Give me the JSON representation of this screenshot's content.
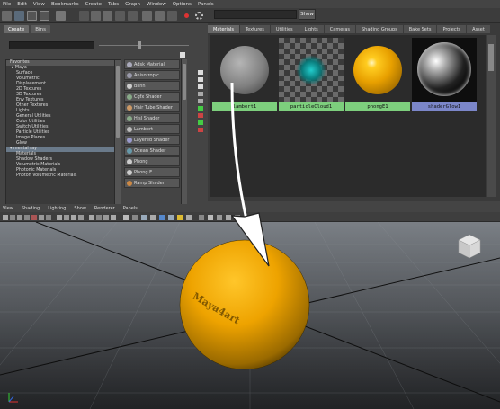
{
  "menubar": [
    "File",
    "Edit",
    "View",
    "Bookmarks",
    "Create",
    "Tabs",
    "Graph",
    "Window",
    "Options",
    "Panels"
  ],
  "toolbar": {
    "show_label": "Show"
  },
  "left_pane": {
    "tabs": [
      "Create",
      "Bins"
    ],
    "tree": [
      {
        "label": "Favorites",
        "kind": "header"
      },
      {
        "label": "▸ Maya",
        "kind": "cat"
      },
      {
        "label": "Surface",
        "kind": "item"
      },
      {
        "label": "Volumetric",
        "kind": "item"
      },
      {
        "label": "Displacement",
        "kind": "item"
      },
      {
        "label": "2D Textures",
        "kind": "item"
      },
      {
        "label": "3D Textures",
        "kind": "item"
      },
      {
        "label": "Env Textures",
        "kind": "item"
      },
      {
        "label": "Other Textures",
        "kind": "item"
      },
      {
        "label": "Lights",
        "kind": "item"
      },
      {
        "label": "General Utilities",
        "kind": "item"
      },
      {
        "label": "Color Utilities",
        "kind": "item"
      },
      {
        "label": "Switch Utilities",
        "kind": "item"
      },
      {
        "label": "Particle Utilities",
        "kind": "item"
      },
      {
        "label": "Image Planes",
        "kind": "item"
      },
      {
        "label": "Glow",
        "kind": "item"
      },
      {
        "label": "▾ mental ray",
        "kind": "sel"
      },
      {
        "label": "Materials",
        "kind": "item"
      },
      {
        "label": "Shadow Shaders",
        "kind": "item"
      },
      {
        "label": "Volumetric Materials",
        "kind": "item"
      },
      {
        "label": "Photonic Materials",
        "kind": "item"
      },
      {
        "label": "Photon Volumetric Materials",
        "kind": "item"
      }
    ],
    "shaders": [
      {
        "label": "Adsk Material",
        "color": "#aab"
      },
      {
        "label": "Anisotropic",
        "color": "#99a"
      },
      {
        "label": "Blinn",
        "color": "#ccc"
      },
      {
        "label": "Cgfx Shader",
        "color": "#8a8"
      },
      {
        "label": "Hair Tube Shader",
        "color": "#c96"
      },
      {
        "label": "Hlsl Shader",
        "color": "#8a8"
      },
      {
        "label": "Lambert",
        "color": "#bbb"
      },
      {
        "label": "Layered Shader",
        "color": "#99c"
      },
      {
        "label": "Ocean Shader",
        "color": "#69a"
      },
      {
        "label": "Phong",
        "color": "#ccc"
      },
      {
        "label": "Phong E",
        "color": "#ccc"
      },
      {
        "label": "Ramp Shader",
        "color": "#c84"
      }
    ]
  },
  "right_pane": {
    "tabs": [
      "Materials",
      "Textures",
      "Utilities",
      "Lights",
      "Cameras",
      "Shading Groups",
      "Bake Sets",
      "Projects",
      "Asset"
    ],
    "swatches": [
      {
        "name": "lambert1",
        "selected": false
      },
      {
        "name": "particleCloud1",
        "selected": false
      },
      {
        "name": "phongE1",
        "selected": false
      },
      {
        "name": "shaderGlow1",
        "selected": true
      }
    ]
  },
  "viewport": {
    "menu": [
      "View",
      "Shading",
      "Lighting",
      "Show",
      "Renderer",
      "Panels"
    ],
    "sphere_text": "Maya4art"
  },
  "colors": {
    "swatch_label": "#7dcf7d",
    "selected_label": "#7b86c9",
    "sphere": "#f0a800"
  }
}
